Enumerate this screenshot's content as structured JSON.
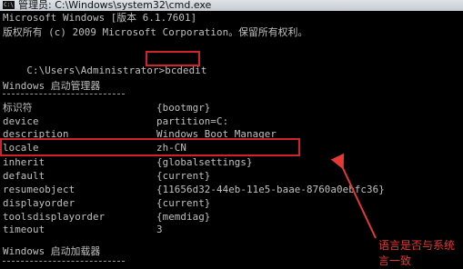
{
  "window": {
    "title": "管理员: C:\\Windows\\system32\\cmd.exe",
    "icon_text": "C:\\"
  },
  "console": {
    "header_line1": "Microsoft Windows [版本 6.1.7601]",
    "header_line2": "版权所有 (c) 2009 Microsoft Corporation。保留所有权利。",
    "prompt": "C:\\Users\\Administrator>",
    "command": "bcdedit",
    "section1_title": "Windows 启动管理器",
    "section1_rule": "--------------------",
    "entries": [
      {
        "key": "标识符",
        "value": "{bootmgr}"
      },
      {
        "key": "device",
        "value": "partition=C:"
      },
      {
        "key": "description",
        "value": "Windows Boot Manager"
      },
      {
        "key": "locale",
        "value": "zh-CN"
      },
      {
        "key": "inherit",
        "value": "{globalsettings}"
      },
      {
        "key": "default",
        "value": "{current}"
      },
      {
        "key": "resumeobject",
        "value": "{11656d32-44eb-11e5-baae-8760a0ebfc36}"
      },
      {
        "key": "displayorder",
        "value": "{current}"
      },
      {
        "key": "toolsdisplayorder",
        "value": "{memdiag}"
      },
      {
        "key": "timeout",
        "value": "3"
      }
    ],
    "section2_title": "Windows 启动加载器",
    "section2_rule": "--------------------"
  },
  "annotation": {
    "line1": "语言是否与系统",
    "line2": "言一致",
    "color": "#e53935"
  }
}
